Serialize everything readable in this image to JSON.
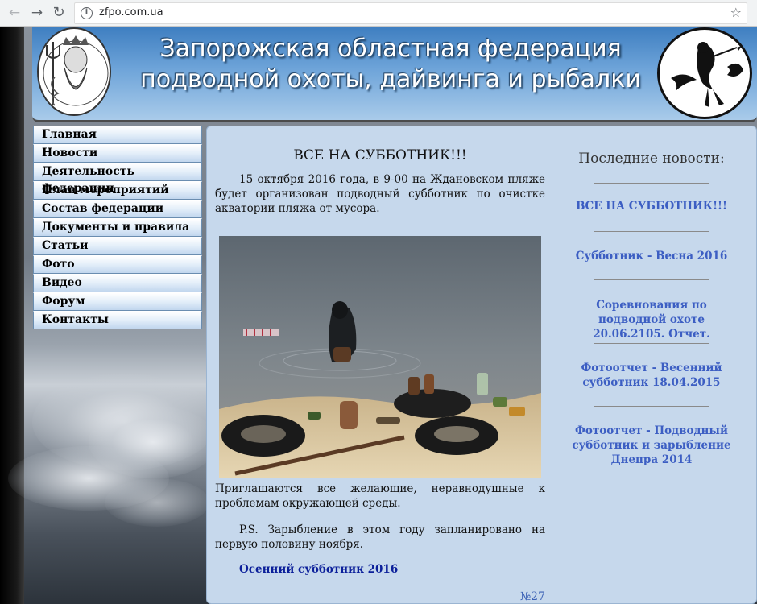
{
  "browser": {
    "url": "zfpo.com.ua",
    "icons": {
      "back": "arrow-left-icon",
      "forward": "arrow-right-icon",
      "reload": "reload-icon",
      "info": "info-icon",
      "bookmark": "star-icon"
    }
  },
  "header": {
    "title_line1": "Запорожская областная федерация",
    "title_line2": "подводной охоты, дайвинга и рыбалки",
    "logo_left": "neptune-logo-icon",
    "logo_right": "diver-logo-icon"
  },
  "menu": {
    "items": [
      {
        "label": "Главная"
      },
      {
        "label": "Новости"
      },
      {
        "label": "Деятельность федерации"
      },
      {
        "label": "План мероприятий"
      },
      {
        "label": "Состав федерации"
      },
      {
        "label": "Документы и правила"
      },
      {
        "label": "Статьи"
      },
      {
        "label": "Фото"
      },
      {
        "label": "Видео"
      },
      {
        "label": "Форум"
      },
      {
        "label": "Контакты"
      }
    ]
  },
  "article": {
    "title": "ВСЕ НА СУББОТНИК!!!",
    "para1": "15 октября 2016 года, в 9-00 на Ждановском пляже будет организован подводный субботник по очистке акватории пляжа от мусора.",
    "para2": "Приглашаются все желающие, неравнодушные к проблемам окружающей среды.",
    "para3": "P.S. Зарыбление в этом году запланировано на первую половину ноября.",
    "link": "Осенний субботник 2016",
    "counter": "№27"
  },
  "news": {
    "heading": "Последние новости:",
    "items": [
      {
        "label": "ВСЕ НА СУББОТНИК!!!"
      },
      {
        "label": "Субботник - Весна 2016"
      },
      {
        "label": "Соревнования по подводной охоте 20.06.2105. Отчет."
      },
      {
        "label": "Фотоотчет - Весенний субботник 18.04.2015"
      },
      {
        "label": "Фотоотчет - Подводный субботник и зарыбление Днепра 2014"
      }
    ]
  },
  "colors": {
    "header_blue": "#3f7fc1",
    "content_bg": "#c6d8ec",
    "news_link": "#3c5ec3",
    "article_link": "#0b1f9a"
  }
}
